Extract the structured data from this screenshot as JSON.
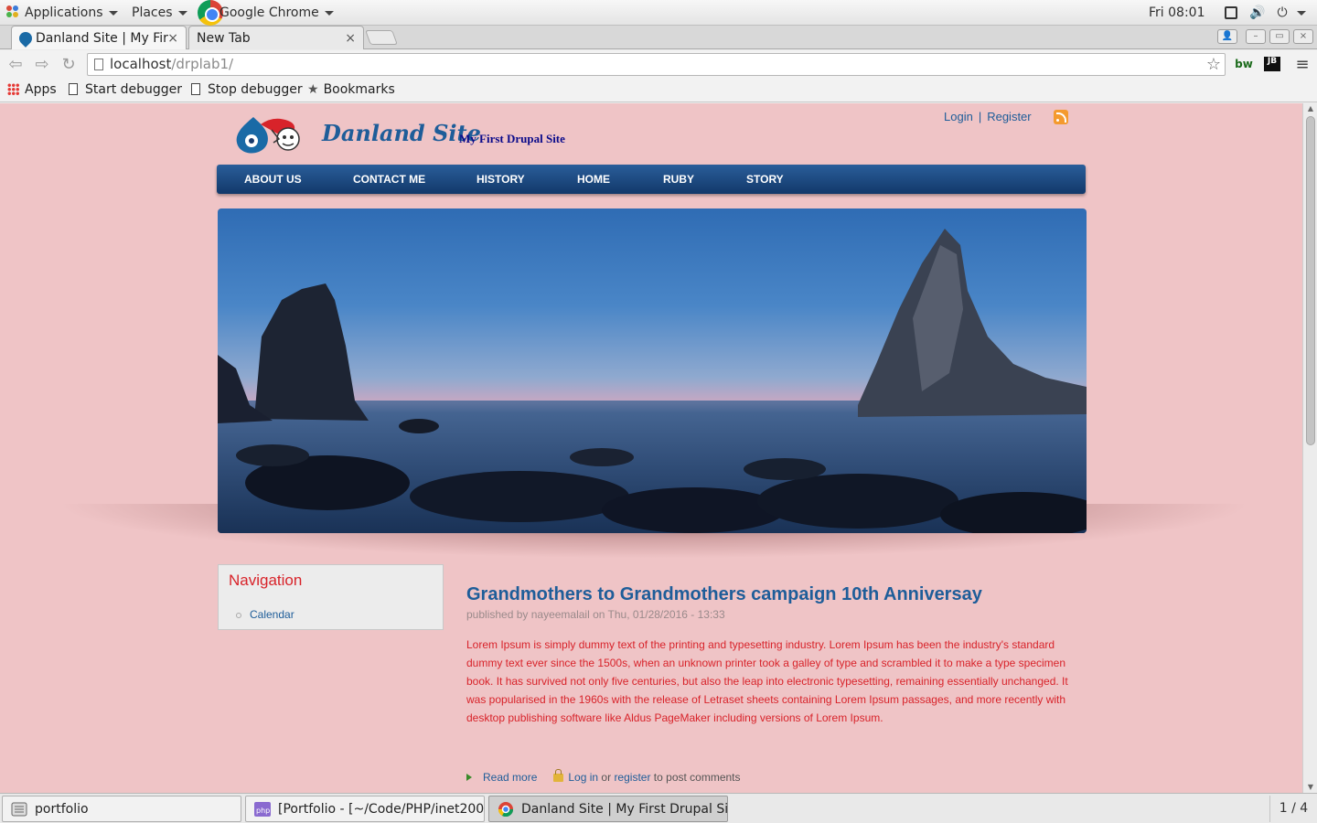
{
  "topbar": {
    "applications": "Applications",
    "places": "Places",
    "active_app": "Google Chrome",
    "clock": "Fri 08:01"
  },
  "tabs": [
    {
      "label": "Danland Site | My Fir",
      "close": "×"
    },
    {
      "label": "New Tab",
      "close": "×"
    }
  ],
  "address": {
    "host": "localhost",
    "path": "/drplab1/"
  },
  "extensions": [
    "bw",
    "JB"
  ],
  "bookmarks": [
    "Apps",
    "Start debugger",
    "Stop debugger",
    "Bookmarks"
  ],
  "site": {
    "name": "Danland Site",
    "slogan": "My First Drupal Site",
    "login": "Login",
    "separator": "|",
    "register": "Register"
  },
  "menu": [
    "ABOUT US",
    "CONTACT ME",
    "HISTORY",
    "HOME",
    "RUBY",
    "STORY"
  ],
  "sidebar": {
    "title": "Navigation",
    "items": [
      "Calendar"
    ]
  },
  "article": {
    "title": "Grandmothers to Grandmothers campaign 10th Anniversay",
    "submitted": "published by nayeemalail on Thu, 01/28/2016 - 13:33",
    "body": "Lorem Ipsum is simply dummy text of the printing and typesetting industry. Lorem Ipsum has been the industry's standard dummy text ever since the 1500s, when an unknown printer took a galley of type and scrambled it to make a type specimen book. It has survived not only five centuries, but also the leap into electronic typesetting, remaining essentially unchanged. It was popularised in the 1960s with the release of Letraset sheets containing Lorem Ipsum passages, and more recently with desktop publishing software like Aldus PageMaker including versions of Lorem Ipsum.",
    "read_more": "Read more",
    "login": "Log in",
    "or": "or",
    "register": "register",
    "to_post": "to post comments"
  },
  "taskbar": {
    "tasks": [
      "portfolio",
      "[Portfolio - [~/Code/PHP/inet200...",
      "Danland Site | My First Drupal Sit..."
    ],
    "pager": "1 / 4"
  },
  "colors": {
    "page_bg": "#efc4c6",
    "menu_bar": "#1e4a82",
    "link": "#1e5d99",
    "body_text": "#d8232a",
    "block_title": "#d8232a"
  }
}
